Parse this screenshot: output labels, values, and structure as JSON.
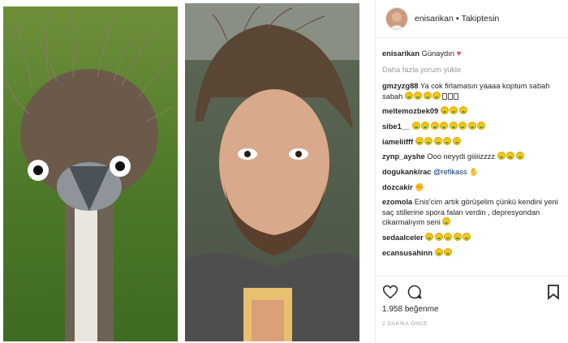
{
  "header": {
    "username": "enisarikan",
    "separator": "•",
    "follow_status": "Takiptesin"
  },
  "caption": {
    "username": "enisarikan",
    "text": "Günaydın"
  },
  "load_more": "Daha fazla yorum yükle",
  "comments": [
    {
      "user": "gmzyzg88",
      "text": "Ya cok firlamasın yaaaa koptum sabah sabah"
    },
    {
      "user": "meltemozbek09",
      "text": ""
    },
    {
      "user": "sibe1__",
      "text": ""
    },
    {
      "user": "iameliifff",
      "text": ""
    },
    {
      "user": "zynp_ayshe",
      "text": "Ooo neyydi giiiiizzzz"
    },
    {
      "user": "dogukankirac",
      "text": "",
      "mention": "@refikass"
    },
    {
      "user": "dozcakir",
      "text": ""
    },
    {
      "user": "ezomola",
      "text": "Enis'cim artık görüşelim çünkü kendini yeni saç stillerine spora falan verdin , depresyondan cikarmalıyım seni"
    },
    {
      "user": "sedaalceler",
      "text": ""
    },
    {
      "user": "ecansusahinn",
      "text": ""
    }
  ],
  "likes": {
    "count": "1.958",
    "label": "beğenme"
  },
  "timestamp": "2 DAKİKA ÖNCE",
  "icons": {
    "like": "heart-outline-icon",
    "comment": "comment-bubble-icon",
    "save": "bookmark-icon"
  },
  "colors": {
    "heart": "#ed4956",
    "mention": "#003569",
    "muted": "#999999",
    "text": "#262626"
  }
}
